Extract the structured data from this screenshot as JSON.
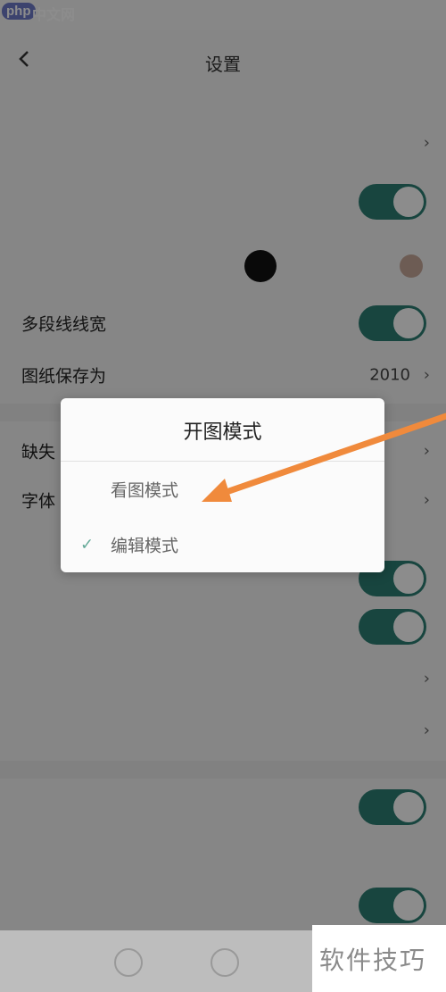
{
  "status_bar": {
    "brand": "php",
    "brand_cn": "中文网",
    "right_text": ""
  },
  "header": {
    "title": "设置",
    "back_icon": "chevron-left-icon"
  },
  "settings": [
    {
      "label": "",
      "value": "",
      "type": "value"
    },
    {
      "label": "",
      "sub": "",
      "type": "toggle",
      "on": true
    },
    {
      "label": "",
      "type": "color"
    },
    {
      "label": "多段线线宽",
      "type": "toggle",
      "on": true
    },
    {
      "label": "图纸保存为",
      "value": "2010",
      "type": "value"
    },
    {
      "label": "缺失",
      "type": "value"
    },
    {
      "label": "字体",
      "type": "value"
    },
    {
      "label": "",
      "type": "toggle",
      "on": true
    },
    {
      "label": "",
      "type": "toggle",
      "on": true
    },
    {
      "label": "",
      "type": "chevron"
    },
    {
      "label": "",
      "type": "chevron"
    },
    {
      "label": "",
      "type": "toggle",
      "on": true
    },
    {
      "label": "",
      "type": "text"
    },
    {
      "label": "",
      "type": "toggle",
      "on": true
    }
  ],
  "dialog": {
    "title": "开图模式",
    "options": [
      {
        "label": "看图模式",
        "selected": false
      },
      {
        "label": "编辑模式",
        "selected": true
      }
    ]
  },
  "annotation": {
    "arrow_color": "#f08a3c"
  },
  "watermark": {
    "text": "软件技巧"
  },
  "colors": {
    "accent": "#2c7f73",
    "overlay": "rgba(0,0,0,0.45)"
  }
}
